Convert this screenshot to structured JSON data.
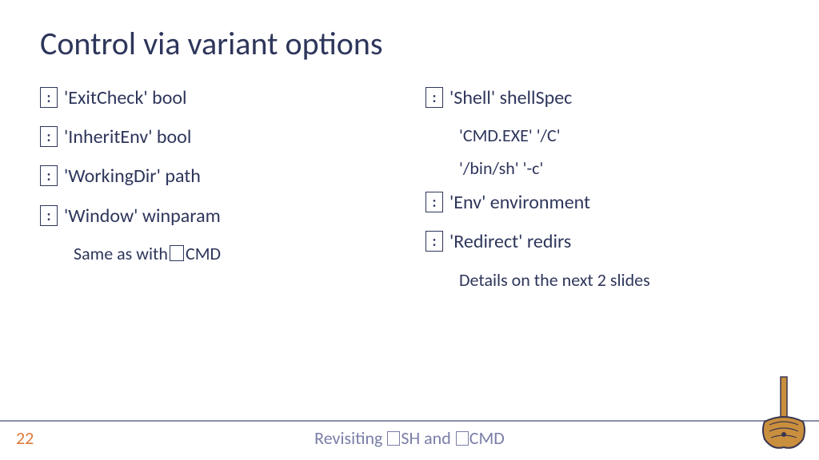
{
  "title": "Control via variant options",
  "bullet_char": ":",
  "left": {
    "i1": "'ExitCheck' bool",
    "i2": "'InheritEnv' bool",
    "i3": "'WorkingDir' path",
    "i4": "'Window' winparam",
    "s1a": "Same as with ",
    "s1b": "CMD"
  },
  "right": {
    "i1": "'Shell' shellSpec",
    "s1": "'CMD.EXE' '/C'",
    "s2": "'/bin/sh' '-c'",
    "i2": "'Env' environment",
    "i3": "'Redirect' redirs",
    "s3": "Details on the next 2 slides"
  },
  "footer": {
    "page": "22",
    "t1": "Revisiting ",
    "t2": "SH and ",
    "t3": "CMD"
  }
}
